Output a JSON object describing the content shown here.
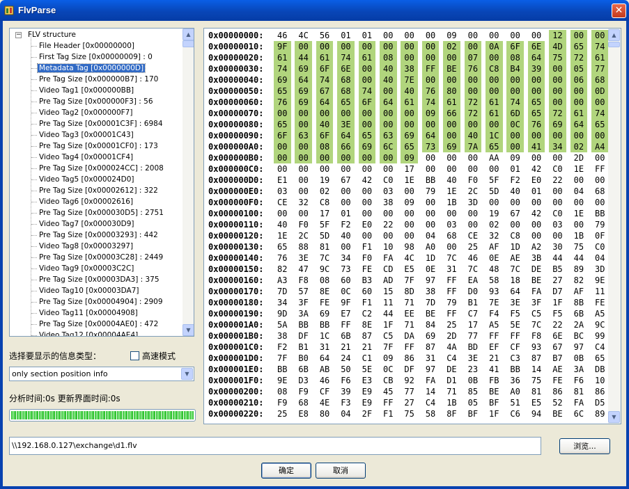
{
  "window": {
    "title": "FlvParse",
    "close_glyph": "✕"
  },
  "tree": {
    "root_label": "FLV structure",
    "expander_glyph": "−",
    "selected_index": 2,
    "items": [
      "File Header [0x00000000]",
      "First Tag Size [0x00000009] : 0",
      "Metadata Tag [0x0000000D]",
      "Pre Tag Size [0x000000B7] : 170",
      "Video Tag1 [0x000000BB]",
      "Pre Tag Size [0x000000F3] : 56",
      "Video Tag2 [0x000000F7]",
      "Pre Tag Size [0x00001C3F] : 6984",
      "Video Tag3 [0x00001C43]",
      "Pre Tag Size [0x00001CF0] : 173",
      "Video Tag4 [0x00001CF4]",
      "Pre Tag Size [0x000024CC] : 2008",
      "Video Tag5 [0x000024D0]",
      "Pre Tag Size [0x00002612] : 322",
      "Video Tag6 [0x00002616]",
      "Pre Tag Size [0x000030D5] : 2751",
      "Video Tag7 [0x000030D9]",
      "Pre Tag Size [0x00003293] : 442",
      "Video Tag8 [0x00003297]",
      "Pre Tag Size [0x00003C28] : 2449",
      "Video Tag9 [0x00003C2C]",
      "Pre Tag Size [0x00003DA3] : 375",
      "Video Tag10 [0x00003DA7]",
      "Pre Tag Size [0x00004904] : 2909",
      "Video Tag11 [0x00004908]",
      "Pre Tag Size [0x00004AE0] : 472",
      "Video Tag12 [0x00004AE4]"
    ]
  },
  "controls": {
    "info_type_label": "选择要显示的信息类型：",
    "fast_mode_label": "高速模式",
    "fast_mode_checked": false,
    "info_type_value": "only section position info",
    "timing_text": "分析时间:0s   更新界面时间:0s",
    "progress_percent": 100
  },
  "hex": {
    "highlight_color": "#b1d57d",
    "highlight_start": 13,
    "highlight_end": 182,
    "rows": [
      {
        "addr": "0x00000000:",
        "bytes": "46 4C 56 01 01 00 00 00 09 00 00 00 00 12 00 00"
      },
      {
        "addr": "0x00000010:",
        "bytes": "9F 00 00 00 00 00 00 00 02 00 0A 6F 6E 4D 65 74"
      },
      {
        "addr": "0x00000020:",
        "bytes": "61 44 61 74 61 08 00 00 00 07 00 08 64 75 72 61"
      },
      {
        "addr": "0x00000030:",
        "bytes": "74 69 6F 6E 00 40 38 FF BE 76 C8 B4 39 00 05 77"
      },
      {
        "addr": "0x00000040:",
        "bytes": "69 64 74 68 00 40 7E 00 00 00 00 00 00 00 06 68"
      },
      {
        "addr": "0x00000050:",
        "bytes": "65 69 67 68 74 00 40 76 80 00 00 00 00 00 00 0D"
      },
      {
        "addr": "0x00000060:",
        "bytes": "76 69 64 65 6F 64 61 74 61 72 61 74 65 00 00 00"
      },
      {
        "addr": "0x00000070:",
        "bytes": "00 00 00 00 00 00 00 09 66 72 61 6D 65 72 61 74"
      },
      {
        "addr": "0x00000080:",
        "bytes": "65 00 40 3E 00 00 00 00 00 00 00 0C 76 69 64 65"
      },
      {
        "addr": "0x00000090:",
        "bytes": "6F 63 6F 64 65 63 69 64 00 40 1C 00 00 00 00 00"
      },
      {
        "addr": "0x000000A0:",
        "bytes": "00 00 08 66 69 6C 65 73 69 7A 65 00 41 34 02 A4"
      },
      {
        "addr": "0x000000B0:",
        "bytes": "00 00 00 00 00 00 09 00 00 00 AA 09 00 00 2D 00"
      },
      {
        "addr": "0x000000C0:",
        "bytes": "00 00 00 00 00 00 17 00 00 00 00 01 42 C0 1E FF"
      },
      {
        "addr": "0x000000D0:",
        "bytes": "E1 00 19 67 42 C0 1E BB 40 F0 5F F2 E0 22 00 00"
      },
      {
        "addr": "0x000000E0:",
        "bytes": "03 00 02 00 00 03 00 79 1E 2C 5D 40 01 00 04 68"
      },
      {
        "addr": "0x000000F0:",
        "bytes": "CE 32 C8 00 00 38 09 00 1B 3D 00 00 00 00 00 00"
      },
      {
        "addr": "0x00000100:",
        "bytes": "00 00 17 01 00 00 00 00 00 00 19 67 42 C0 1E BB"
      },
      {
        "addr": "0x00000110:",
        "bytes": "40 F0 5F F2 E0 22 00 00 03 00 02 00 00 03 00 79"
      },
      {
        "addr": "0x00000120:",
        "bytes": "1E 2C 5D 40 00 00 00 04 68 CE 32 C8 00 00 1B 0F"
      },
      {
        "addr": "0x00000130:",
        "bytes": "65 88 81 00 F1 10 98 A0 00 25 AF 1D A2 30 75 C0"
      },
      {
        "addr": "0x00000140:",
        "bytes": "76 3E 7C 34 F0 FA 4C 1D 7C 46 0E AE 3B 44 44 04"
      },
      {
        "addr": "0x00000150:",
        "bytes": "82 47 9C 73 FE CD E5 0E 31 7C 48 7C DE B5 89 3D"
      },
      {
        "addr": "0x00000160:",
        "bytes": "A3 F8 08 60 B3 AD 7F 97 FF EA 58 18 BE 27 82 9E"
      },
      {
        "addr": "0x00000170:",
        "bytes": "7D 57 8E 0C 60 15 8D 38 FF D0 93 64 FA D7 AF 11"
      },
      {
        "addr": "0x00000180:",
        "bytes": "34 3F FE 9F F1 11 71 7D 79 B1 7E 3E 3F 1F 8B FE"
      },
      {
        "addr": "0x00000190:",
        "bytes": "9D 3A 69 E7 C2 44 EE BE FF C7 F4 F5 C5 F5 6B A5"
      },
      {
        "addr": "0x000001A0:",
        "bytes": "5A BB BB FF 8E 1F 71 84 25 17 A5 5E 7C 22 2A 9C"
      },
      {
        "addr": "0x000001B0:",
        "bytes": "38 DF 1C 6B 87 C5 DA 69 2D 77 FF FF F8 6E BC 99"
      },
      {
        "addr": "0x000001C0:",
        "bytes": "F2 B1 31 21 21 7F FF 87 4A BD EF CF 93 67 97 C4"
      },
      {
        "addr": "0x000001D0:",
        "bytes": "7F B0 64 24 C1 09 86 31 C4 3E 21 C3 87 B7 0B 65"
      },
      {
        "addr": "0x000001E0:",
        "bytes": "BB 6B AB 50 5E 0C DF 97 DE 23 41 BB 14 AE 3A DB"
      },
      {
        "addr": "0x000001F0:",
        "bytes": "9E D3 46 F6 E3 CB 92 FA D1 0B FB 36 75 FE F6 10"
      },
      {
        "addr": "0x00000200:",
        "bytes": "08 F9 CF 39 E9 45 77 14 71 85 BE A0 81 86 81 86"
      },
      {
        "addr": "0x00000210:",
        "bytes": "F9 68 4E F3 E9 FF 27 C4 1B 05 BF 51 E5 52 FA D5"
      },
      {
        "addr": "0x00000220:",
        "bytes": "25 E8 80 04 2F F1 75 58 8F BF 1F C6 94 BE 6C 89"
      }
    ]
  },
  "path": {
    "value": "\\\\192.168.0.127\\exchange\\d1.flv"
  },
  "buttons": {
    "browse": "浏览...",
    "ok": "确定",
    "cancel": "取消"
  },
  "icons": {
    "app": "app-icon",
    "up": "▲",
    "down": "▼"
  }
}
